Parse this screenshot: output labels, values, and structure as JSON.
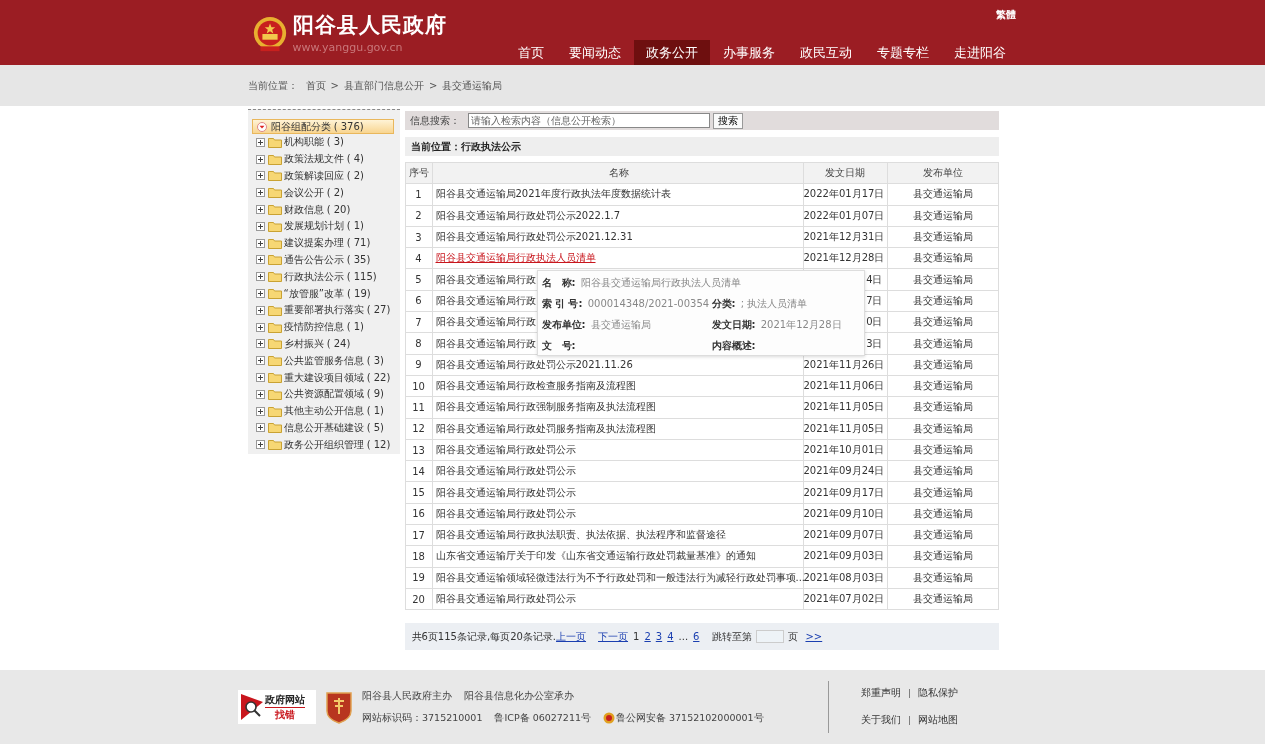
{
  "header": {
    "site_title": "阳谷县人民政府",
    "site_url": "www.yanggu.gov.cn",
    "lang_switch": "繁體",
    "nav": [
      {
        "label": "首页",
        "selected": false
      },
      {
        "label": "要闻动态",
        "selected": false
      },
      {
        "label": "政务公开",
        "selected": true
      },
      {
        "label": "办事服务",
        "selected": false
      },
      {
        "label": "政民互动",
        "selected": false
      },
      {
        "label": "专题专栏",
        "selected": false
      },
      {
        "label": "走进阳谷",
        "selected": false
      }
    ]
  },
  "breadcrumb": {
    "label": "当前位置：",
    "items": [
      "首页",
      "县直部门信息公开",
      "县交通运输局"
    ],
    "separator": ">"
  },
  "sidebar": {
    "tree": {
      "label": "阳谷组配分类 ( 376)",
      "selected": true,
      "expanded": true,
      "children": [
        {
          "label": "机构职能 ( 3)",
          "selected": false,
          "expanded": false
        },
        {
          "label": "政策法规文件 ( 4)",
          "selected": false,
          "expanded": false
        },
        {
          "label": "政策解读回应 ( 2)",
          "selected": false,
          "expanded": false
        },
        {
          "label": "会议公开 ( 2)",
          "selected": false,
          "expanded": false
        },
        {
          "label": "财政信息 ( 20)",
          "selected": false,
          "expanded": false
        },
        {
          "label": "发展规划计划 ( 1)",
          "selected": false,
          "expanded": false
        },
        {
          "label": "建议提案办理 ( 71)",
          "selected": false,
          "expanded": false
        },
        {
          "label": "通告公告公示 ( 35)",
          "selected": false,
          "expanded": false
        },
        {
          "label": "行政执法公示 ( 115)",
          "selected": false,
          "expanded": false
        },
        {
          "label": "“放管服”改革 ( 19)",
          "selected": false,
          "expanded": false
        },
        {
          "label": "重要部署执行落实 ( 27)",
          "selected": false,
          "expanded": false
        },
        {
          "label": "疫情防控信息 ( 1)",
          "selected": false,
          "expanded": false
        },
        {
          "label": "乡村振兴 ( 24)",
          "selected": false,
          "expanded": false
        },
        {
          "label": "公共监管服务信息 ( 3)",
          "selected": false,
          "expanded": false
        },
        {
          "label": "重大建设项目领域 ( 22)",
          "selected": false,
          "expanded": false
        },
        {
          "label": "公共资源配置领域 ( 9)",
          "selected": false,
          "expanded": false
        },
        {
          "label": "其他主动公开信息 ( 1)",
          "selected": false,
          "expanded": false
        },
        {
          "label": "信息公开基础建设 ( 5)",
          "selected": false,
          "expanded": false
        },
        {
          "label": "政务公开组织管理 ( 12)",
          "selected": false,
          "expanded": false
        }
      ]
    }
  },
  "search": {
    "label": "信息搜索：",
    "placeholder": "请输入检索内容（信息公开检索）",
    "button": "搜索"
  },
  "section_title": "当前位置：行政执法公示",
  "table": {
    "columns": [
      "序号",
      "名称",
      "发文日期",
      "发布单位"
    ],
    "rows": [
      {
        "no": "1",
        "name": "阳谷县交通运输局2021年度行政执法年度数据统计表",
        "date": "2022年01月17日",
        "unit": "县交通运输局",
        "hovered": false
      },
      {
        "no": "2",
        "name": "阳谷县交通运输局行政处罚公示2022.1.7",
        "date": "2022年01月07日",
        "unit": "县交通运输局",
        "hovered": false
      },
      {
        "no": "3",
        "name": "阳谷县交通运输局行政处罚公示2021.12.31",
        "date": "2021年12月31日",
        "unit": "县交通运输局",
        "hovered": false
      },
      {
        "no": "4",
        "name": "阳谷县交通运输局行政执法人员清单",
        "date": "2021年12月28日",
        "unit": "县交通运输局",
        "hovered": true
      },
      {
        "no": "5",
        "name": "阳谷县交通运输局行政",
        "date": "4日",
        "unit": "县交通运输局",
        "hovered": false
      },
      {
        "no": "6",
        "name": "阳谷县交通运输局行政",
        "date": "7日",
        "unit": "县交通运输局",
        "hovered": false
      },
      {
        "no": "7",
        "name": "阳谷县交通运输局行政",
        "date": "0日",
        "unit": "县交通运输局",
        "hovered": false
      },
      {
        "no": "8",
        "name": "阳谷县交通运输局行政",
        "date": "3日",
        "unit": "县交通运输局",
        "hovered": false
      },
      {
        "no": "9",
        "name": "阳谷县交通运输局行政处罚公示2021.11.26",
        "date": "2021年11月26日",
        "unit": "县交通运输局",
        "hovered": false
      },
      {
        "no": "10",
        "name": "阳谷县交通运输局行政检查服务指南及流程图",
        "date": "2021年11月06日",
        "unit": "县交通运输局",
        "hovered": false
      },
      {
        "no": "11",
        "name": "阳谷县交通运输局行政强制服务指南及执法流程图",
        "date": "2021年11月05日",
        "unit": "县交通运输局",
        "hovered": false
      },
      {
        "no": "12",
        "name": "阳谷县交通运输局行政处罚服务指南及执法流程图",
        "date": "2021年11月05日",
        "unit": "县交通运输局",
        "hovered": false
      },
      {
        "no": "13",
        "name": "阳谷县交通运输局行政处罚公示",
        "date": "2021年10月01日",
        "unit": "县交通运输局",
        "hovered": false
      },
      {
        "no": "14",
        "name": "阳谷县交通运输局行政处罚公示",
        "date": "2021年09月24日",
        "unit": "县交通运输局",
        "hovered": false
      },
      {
        "no": "15",
        "name": "阳谷县交通运输局行政处罚公示",
        "date": "2021年09月17日",
        "unit": "县交通运输局",
        "hovered": false
      },
      {
        "no": "16",
        "name": "阳谷县交通运输局行政处罚公示",
        "date": "2021年09月10日",
        "unit": "县交通运输局",
        "hovered": false
      },
      {
        "no": "17",
        "name": "阳谷县交通运输局行政执法职责、执法依据、执法程序和监督途径",
        "date": "2021年09月07日",
        "unit": "县交通运输局",
        "hovered": false
      },
      {
        "no": "18",
        "name": "山东省交通运输厅关于印发《山东省交通运输行政处罚裁量基准》的通知",
        "date": "2021年09月03日",
        "unit": "县交通运输局",
        "hovered": false
      },
      {
        "no": "19",
        "name": "阳谷县交通运输领域轻微违法行为不予行政处罚和一般违法行为减轻行政处罚事项...",
        "date": "2021年08月03日",
        "unit": "县交通运输局",
        "hovered": false
      },
      {
        "no": "20",
        "name": "阳谷县交通运输局行政处罚公示",
        "date": "2021年07月02日",
        "unit": "县交通运输局",
        "hovered": false
      }
    ]
  },
  "tooltip": {
    "fields": [
      {
        "label": "名　称:",
        "value": "阳谷县交通运输局行政执法人员清单"
      },
      {
        "label": "索 引 号:",
        "value": "000014348/2021-00354"
      },
      {
        "label": "分类:",
        "value": "; 执法人员清单"
      },
      {
        "label": "发布单位:",
        "value": "县交通运输局"
      },
      {
        "label": "发文日期:",
        "value": "2021年12月28日"
      },
      {
        "label": "文　号:"
      },
      {
        "label": "内容概述:"
      }
    ]
  },
  "pager": {
    "summary": "共6页115条记录,每页20条记录.",
    "prev": "上一页",
    "next": "下一页",
    "pages": [
      {
        "label": "1",
        "selected": true
      },
      {
        "label": "2",
        "selected": false
      },
      {
        "label": "3",
        "selected": false
      },
      {
        "label": "4",
        "selected": false
      },
      {
        "label": "...",
        "kind": "gap"
      },
      {
        "label": "6",
        "selected": false
      }
    ],
    "jump_label": "跳转至第",
    "jump_suffix": "页",
    "go": ">>"
  },
  "footer": {
    "badge_top": "政府网站",
    "badge_bottom": "找错",
    "lines": [
      [
        "阳谷县人民政府主办",
        "阳谷县信息化办公室承办"
      ],
      [
        "网站标识码：3715210001",
        "鲁ICP备 06027211号",
        "鲁公网安备 37152102000001号"
      ]
    ],
    "links": [
      [
        "郑重声明",
        "隐私保护"
      ],
      [
        "关于我们",
        "网站地图"
      ]
    ],
    "link_separator": "|"
  }
}
